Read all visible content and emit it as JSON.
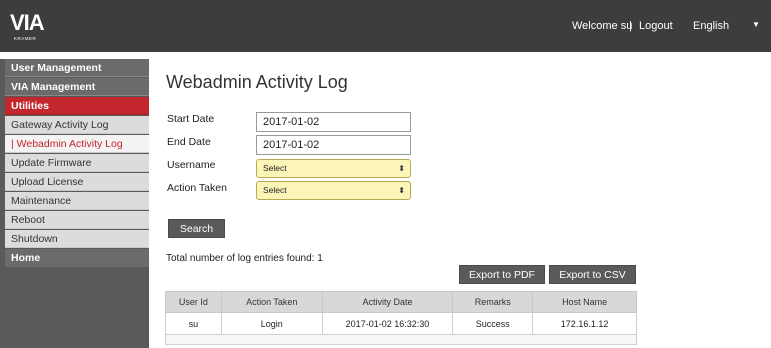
{
  "header": {
    "logo_text": "VIA",
    "logo_sub": "KRAMER",
    "welcome": "Welcome su",
    "separator": "|",
    "logout": "Logout",
    "language": "English",
    "colors": {
      "bar": "#3d3d3d"
    }
  },
  "sidebar": {
    "items": [
      {
        "label": "User Management"
      },
      {
        "label": "VIA Management"
      },
      {
        "label": "Utilities"
      },
      {
        "label": "Gateway Activity Log"
      },
      {
        "label": "| Webadmin Activity Log"
      },
      {
        "label": "Update Firmware"
      },
      {
        "label": "Upload License"
      },
      {
        "label": "Maintenance"
      },
      {
        "label": "Reboot"
      },
      {
        "label": "Shutdown"
      },
      {
        "label": "Home"
      }
    ],
    "colors": {
      "accent": "#c4262e",
      "section": "#6b6b6b"
    }
  },
  "main": {
    "title": "Webadmin Activity Log",
    "form": {
      "start_date_label": "Start Date",
      "start_date_value": "2017-01-02",
      "end_date_label": "End Date",
      "end_date_value": "2017-01-02",
      "username_label": "Username",
      "username_value": "Select",
      "action_label": "Action Taken",
      "action_value": "Select",
      "search_button": "Search"
    },
    "total_text": "Total number of log entries found: 1",
    "export_pdf": "Export to PDF",
    "export_csv": "Export to CSV",
    "table": {
      "headers": [
        "User Id",
        "Action Taken",
        "Activity Date",
        "Remarks",
        "Host Name"
      ],
      "rows": [
        [
          "su",
          "Login",
          "2017-01-02 16:32:30",
          "Success",
          "172.16.1.12"
        ]
      ]
    }
  }
}
